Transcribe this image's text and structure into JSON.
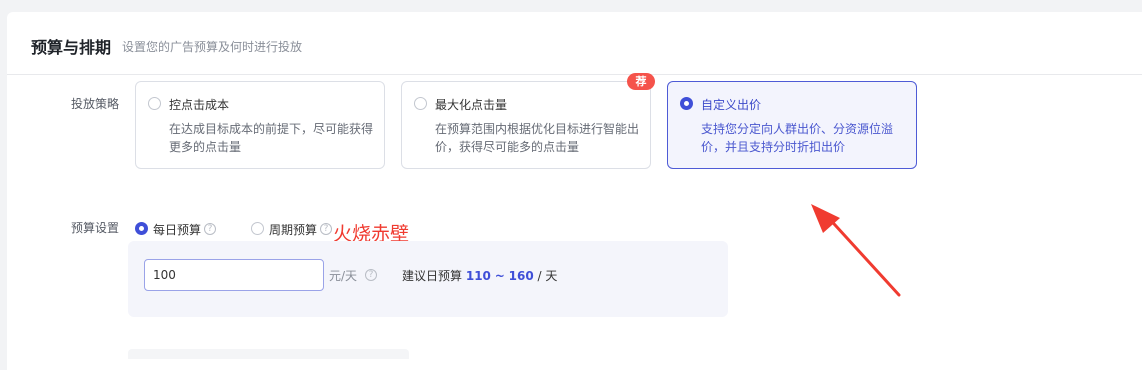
{
  "header": {
    "title": "预算与排期",
    "subtitle": "设置您的广告预算及何时进行投放"
  },
  "strategy": {
    "label": "投放策略",
    "recommend_badge": "荐",
    "options": [
      {
        "title": "控点击成本",
        "desc": "在达成目标成本的前提下，尽可能获得更多的点击量",
        "selected": false
      },
      {
        "title": "最大化点击量",
        "desc": "在预算范围内根据优化目标进行智能出价，获得尽可能多的点击量",
        "selected": false
      },
      {
        "title": "自定义出价",
        "desc": "支持您分定向人群出价、分资源位溢价，并且支持分时折扣出价",
        "selected": true
      }
    ]
  },
  "budget": {
    "label": "预算设置",
    "daily_label": "每日预算",
    "period_label": "周期预算",
    "help_glyph": "?",
    "input_value": "100",
    "unit": "元/天",
    "suggest_prefix": "建议日预算",
    "suggest_min": "110",
    "suggest_sep": "~",
    "suggest_max": "160",
    "suggest_suffix": "/ 天"
  },
  "annotation": {
    "watermark_text": "火烧赤壁",
    "arrow_color": "#f03b30"
  },
  "colors": {
    "accent": "#3f4fd8",
    "badge": "#f5534b"
  }
}
